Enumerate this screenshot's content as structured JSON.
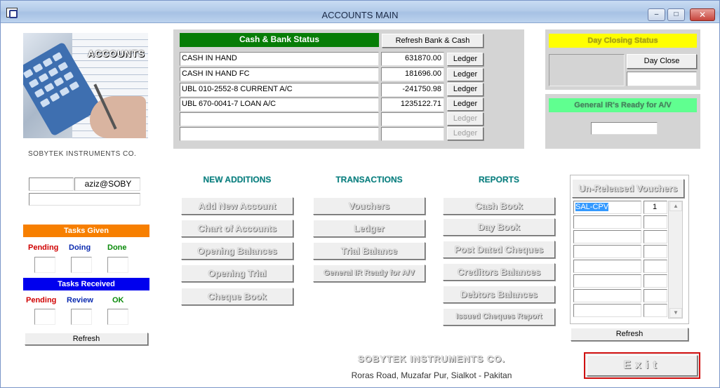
{
  "window": {
    "title": "ACCOUNTS MAIN",
    "min_glyph": "–",
    "max_glyph": "□",
    "close_glyph": "✕"
  },
  "logo": {
    "word": "ACCOUNTS"
  },
  "company_short": "SOBYTEK INSTRUMENTS CO.",
  "user": {
    "blank": "",
    "name": "aziz@SOBY",
    "note": ""
  },
  "cash_bank": {
    "header": "Cash & Bank Status",
    "refresh_label": "Refresh Bank & Cash",
    "ledger_label": "Ledger",
    "rows": [
      {
        "name": "CASH IN HAND",
        "amount": "631870.00",
        "ledger_enabled": true
      },
      {
        "name": "CASH IN HAND FC",
        "amount": "181696.00",
        "ledger_enabled": true
      },
      {
        "name": "UBL 010-2552-8 CURRENT A/C",
        "amount": "-241750.98",
        "ledger_enabled": true
      },
      {
        "name": "UBL 670-0041-7 LOAN A/C",
        "amount": "1235122.71",
        "ledger_enabled": true
      },
      {
        "name": "",
        "amount": "",
        "ledger_enabled": false
      },
      {
        "name": "",
        "amount": "",
        "ledger_enabled": false
      }
    ]
  },
  "day_closing": {
    "header": "Day Closing Status",
    "button": "Day Close",
    "value": ""
  },
  "gen_ir": {
    "header": "General IR's Ready for A/V",
    "value": ""
  },
  "sections": {
    "new_additions": {
      "title": "NEW ADDITIONS",
      "buttons": [
        "Add New Account",
        "Chart of Accounts",
        "Opening Balances",
        "Opening Trial",
        "Cheque Book"
      ]
    },
    "transactions": {
      "title": "TRANSACTIONS",
      "buttons": [
        "Vouchers",
        "Ledger",
        "Trial Balance",
        "General IR Ready for A/V"
      ]
    },
    "reports": {
      "title": "REPORTS",
      "buttons": [
        "Cash Book",
        "Day Book",
        "Post Dated Cheques",
        "Creditors Balances",
        "Debtors Balances",
        "Issued Cheques Report"
      ]
    }
  },
  "unreleased": {
    "button": "Un-Released Vouchers",
    "rows": [
      {
        "type": "SAL-CPV",
        "count": "1"
      },
      {
        "type": "",
        "count": ""
      },
      {
        "type": "",
        "count": ""
      },
      {
        "type": "",
        "count": ""
      },
      {
        "type": "",
        "count": ""
      },
      {
        "type": "",
        "count": ""
      },
      {
        "type": "",
        "count": ""
      },
      {
        "type": "",
        "count": ""
      }
    ],
    "refresh": "Refresh"
  },
  "tasks_given": {
    "title": "Tasks Given",
    "color": "#f77f00",
    "labels": [
      "Pending",
      "Doing",
      "Done"
    ],
    "label_colors": [
      "#d00000",
      "#0b2bb0",
      "#0a8a0a"
    ]
  },
  "tasks_received": {
    "title": "Tasks Received",
    "color": "#0000ee",
    "labels": [
      "Pending",
      "Review",
      "OK"
    ],
    "label_colors": [
      "#d00000",
      "#0b2bb0",
      "#0a8a0a"
    ]
  },
  "tasks_refresh": "Refresh",
  "footer": {
    "company": "SOBYTEK INSTRUMENTS CO.",
    "address": "Roras Road, Muzafar Pur, Sialkot - Pakitan"
  },
  "exit_label": "Exit",
  "colors": {
    "panel_grey": "#d4d4d4",
    "cash_header_green": "#077d07",
    "day_closing_yellow": "#ffff00",
    "gen_ir_green": "#60ff90",
    "selected_blue": "#3399ff"
  }
}
